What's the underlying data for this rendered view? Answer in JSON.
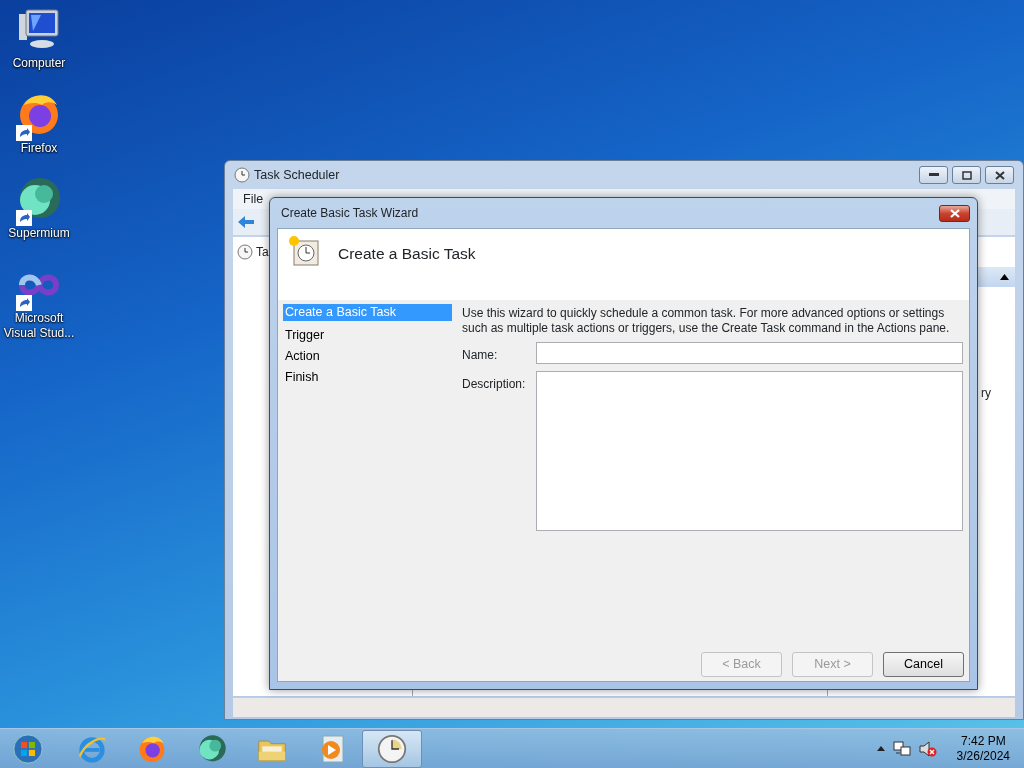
{
  "desktop_icons": [
    {
      "label": "Computer",
      "kind": "computer",
      "shortcut": false
    },
    {
      "label": "Firefox",
      "kind": "firefox",
      "shortcut": true
    },
    {
      "label": "Supermium",
      "kind": "supermium",
      "shortcut": true
    },
    {
      "label": "Microsoft Visual Stud...",
      "kind": "vstudio",
      "shortcut": true
    }
  ],
  "background_window": {
    "title": "Task Scheduler",
    "menu": [
      "File"
    ],
    "tree_item": "Ta",
    "actions_text": "ry"
  },
  "dialog": {
    "title": "Create Basic Task Wizard",
    "heading": "Create a Basic Task",
    "steps": [
      {
        "label": "Create a Basic Task",
        "selected": true
      },
      {
        "label": "Trigger",
        "selected": false
      },
      {
        "label": "Action",
        "selected": false
      },
      {
        "label": "Finish",
        "selected": false
      }
    ],
    "intro": "Use this wizard to quickly schedule a common task.  For more advanced options or settings such as multiple task actions or triggers, use the Create Task command in the Actions pane.",
    "name_label": "Name:",
    "description_label": "Description:",
    "buttons": [
      {
        "label": "< Back",
        "disabled": true
      },
      {
        "label": "Next >",
        "disabled": true
      },
      {
        "label": "Cancel",
        "disabled": false
      }
    ]
  },
  "taskbar": {
    "apps": [
      {
        "kind": "ie",
        "selected": false
      },
      {
        "kind": "firefox",
        "selected": false
      },
      {
        "kind": "supermium",
        "selected": false
      },
      {
        "kind": "explorer",
        "selected": false
      },
      {
        "kind": "media",
        "selected": false
      },
      {
        "kind": "clock",
        "selected": true
      }
    ],
    "time": "7:42 PM",
    "date": "3/26/2024"
  }
}
